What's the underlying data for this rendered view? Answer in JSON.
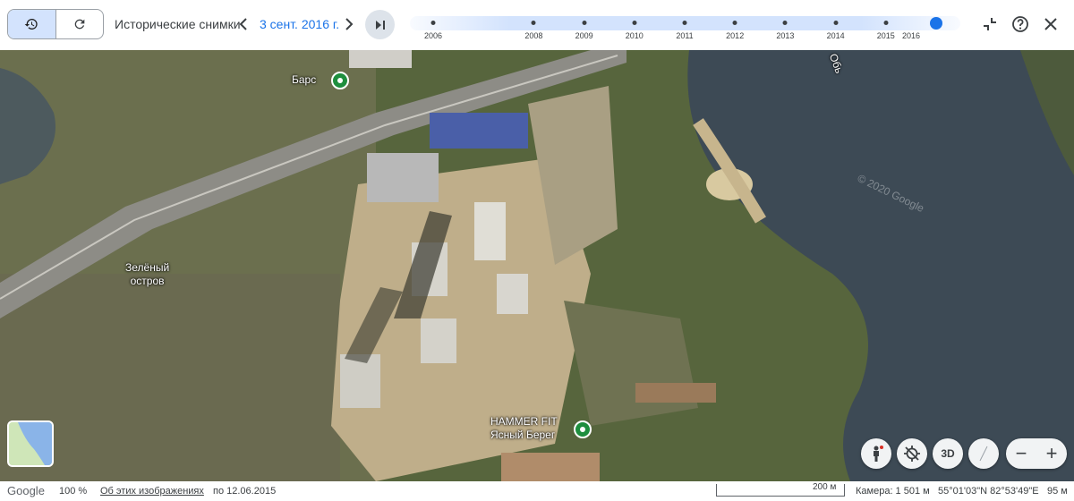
{
  "header": {
    "historical_label": "Исторические снимки",
    "current_date": "3 сент. 2016 г.",
    "timeline": {
      "years": [
        "2006",
        "2008",
        "2009",
        "2010",
        "2011",
        "2012",
        "2013",
        "2014",
        "2015",
        "2016"
      ],
      "selected_year": "2016"
    }
  },
  "icons": {
    "history": "history-icon",
    "refresh": "refresh-icon",
    "prev": "chevron-left-icon",
    "next": "chevron-right-icon",
    "latest": "skip-to-latest-icon",
    "collapse": "collapse-icon",
    "help": "help-icon",
    "close": "close-icon",
    "pegman": "pegman-icon",
    "compass": "compass-icon",
    "tilt": "tilt-icon"
  },
  "map": {
    "labels": {
      "bars": "Барс",
      "ob": "Обь",
      "green_island": "Зелёный\nостров",
      "hammer_fit": "HAMMER FIT\nЯсный Берег",
      "watermark": "© 2020 Google"
    },
    "controls": {
      "three_d": "3D",
      "zoom_out": "−",
      "zoom_in": "+"
    }
  },
  "footer": {
    "logo": "Google",
    "zoom": "100 %",
    "about": "Об этих изображениях",
    "imagery_date": "по 12.06.2015",
    "scale": "200 м",
    "camera": "Камера: 1 501 м",
    "coordinates": "55°01'03\"N 82°53'49\"E",
    "elevation": "95 м"
  },
  "colors": {
    "accent": "#1a73e8",
    "timeline_bg": "#d3e3fd",
    "pin_green": "#1e8e3e",
    "river": "#3d4a55"
  }
}
